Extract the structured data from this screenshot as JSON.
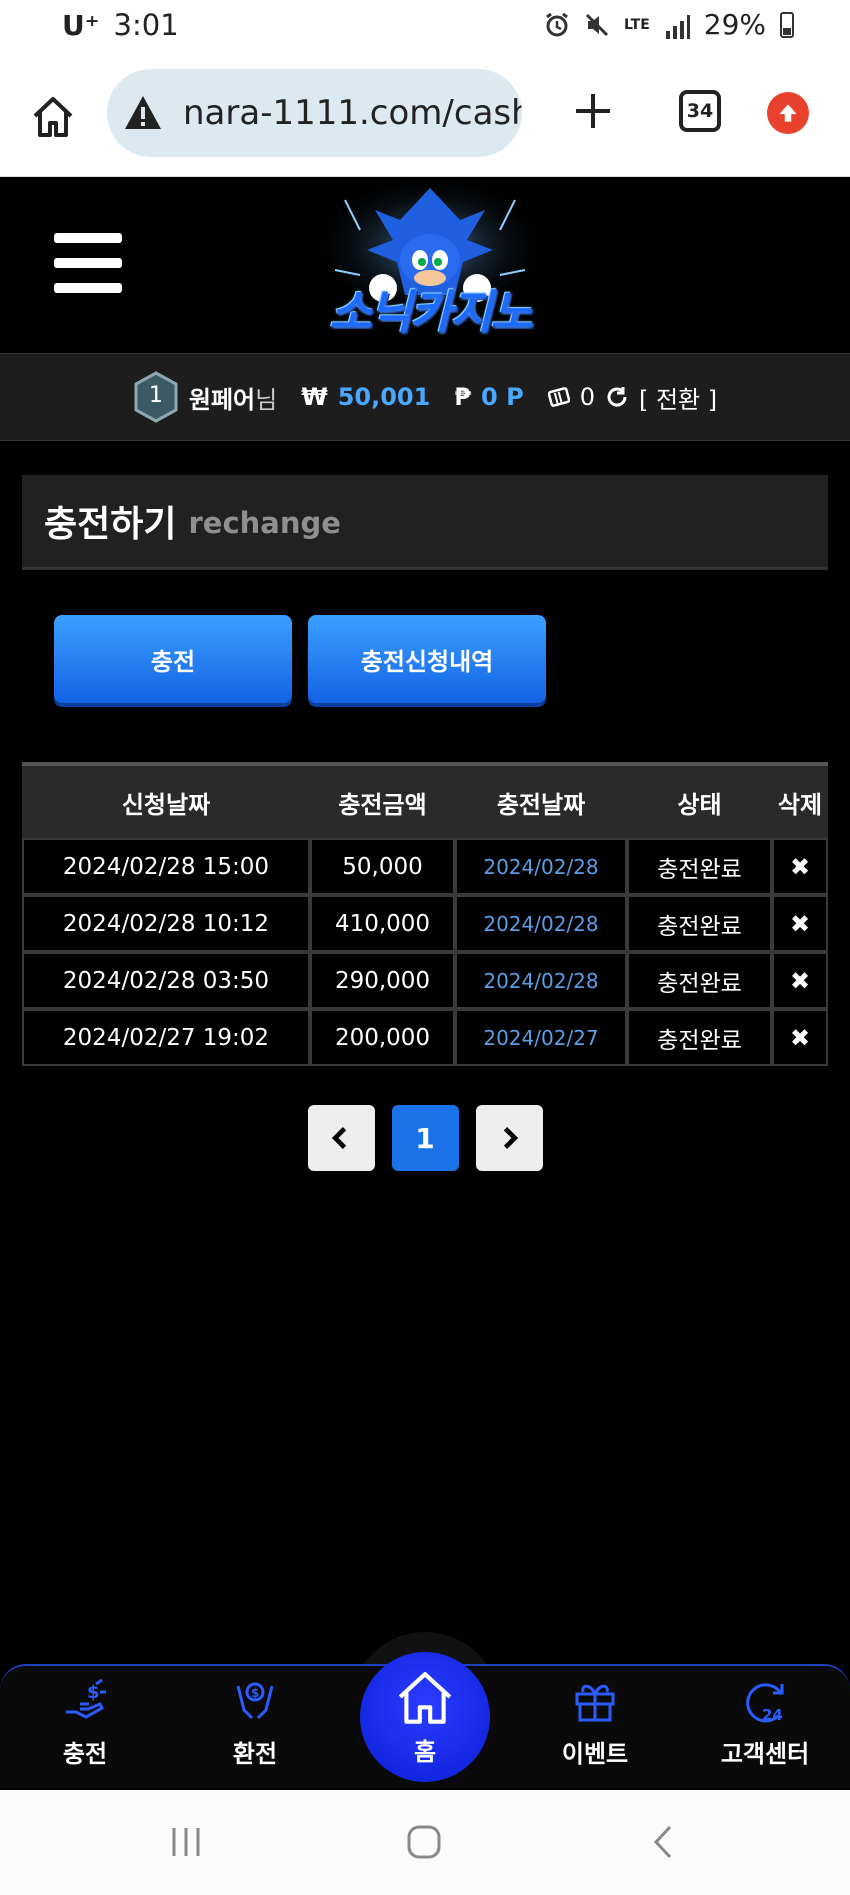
{
  "status_bar": {
    "carrier": "U⁺",
    "time": "3:01",
    "network": "LTE",
    "battery": "29%"
  },
  "browser": {
    "url": "nara-1111.com/cash",
    "tab_count": "34"
  },
  "site": {
    "logo_text": "소닉카지노"
  },
  "user": {
    "level": "1",
    "name": "원페어",
    "suffix": "님",
    "money_symbol": "₩",
    "money": "50,001",
    "point_symbol": "₱",
    "points": "0 P",
    "coupons": "0",
    "convert_label": "[ 전환 ]"
  },
  "section": {
    "title_ko": "충전하기",
    "title_en": "rechange"
  },
  "actions": {
    "charge_label": "충전",
    "history_label": "충전신청내역"
  },
  "table": {
    "headers": [
      "신청날짜",
      "충전금액",
      "충전날짜",
      "상태",
      "삭제"
    ],
    "rows": [
      {
        "requested": "2024/02/28 15:00",
        "amount": "50,000",
        "charged": "2024/02/28",
        "status": "충전완료"
      },
      {
        "requested": "2024/02/28 10:12",
        "amount": "410,000",
        "charged": "2024/02/28",
        "status": "충전완료"
      },
      {
        "requested": "2024/02/28 03:50",
        "amount": "290,000",
        "charged": "2024/02/28",
        "status": "충전완료"
      },
      {
        "requested": "2024/02/27 19:02",
        "amount": "200,000",
        "charged": "2024/02/27",
        "status": "충전완료"
      }
    ],
    "delete_symbol": "✖"
  },
  "pagination": {
    "current": "1"
  },
  "bottom_nav": {
    "charge": "충전",
    "exchange": "환전",
    "home": "홈",
    "event": "이벤트",
    "support": "고객센터",
    "support_badge": "24"
  },
  "colors": {
    "accent_blue": "#1a73e8",
    "link_blue": "#5a9ee6",
    "money_blue": "#4aa8ff",
    "update_red": "#e8412e"
  }
}
